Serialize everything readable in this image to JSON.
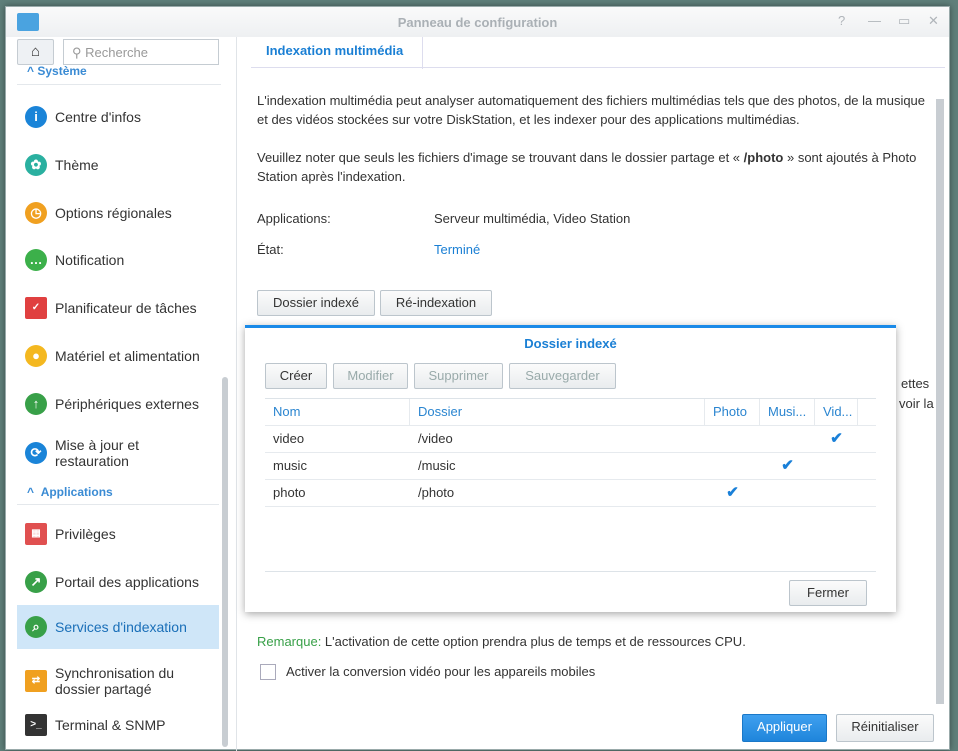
{
  "window": {
    "title": "Panneau de configuration",
    "controls": [
      "?",
      "—",
      "▭",
      "✕"
    ]
  },
  "search": {
    "placeholder": "Recherche"
  },
  "sidebar": {
    "section_system": "Système",
    "section_apps": "Applications",
    "items": [
      {
        "label": "Centre d'infos",
        "icon": "info-icon",
        "color": "#1a84d8",
        "glyph": "i"
      },
      {
        "label": "Thème",
        "icon": "palette-icon",
        "color": "#2ab0a0",
        "glyph": "✿"
      },
      {
        "label": "Options régionales",
        "icon": "regional-icon",
        "color": "#f0a020",
        "glyph": "◷"
      },
      {
        "label": "Notification",
        "icon": "chat-icon",
        "color": "#3cb04a",
        "glyph": "…"
      },
      {
        "label": "Planificateur de tâches",
        "icon": "calendar-icon",
        "color": "#e04040",
        "glyph": "✓"
      },
      {
        "label": "Matériel et alimentation",
        "icon": "bulb-icon",
        "color": "#f4b820",
        "glyph": "●"
      },
      {
        "label": "Périphériques externes",
        "icon": "upload-icon",
        "color": "#38a048",
        "glyph": "↑"
      },
      {
        "label": "Mise à jour et restauration",
        "icon": "refresh-icon",
        "color": "#1a84d8",
        "glyph": "⟳"
      },
      {
        "label": "Privilèges",
        "icon": "grid-icon",
        "color": "#e05050",
        "glyph": "▦"
      },
      {
        "label": "Portail des applications",
        "icon": "portal-icon",
        "color": "#38a048",
        "glyph": "↗"
      },
      {
        "label": "Services d'indexation",
        "icon": "index-search-icon",
        "color": "#38a048",
        "glyph": "⌕"
      },
      {
        "label": "Synchronisation du dossier partagé",
        "icon": "sync-folder-icon",
        "color": "#f0a020",
        "glyph": "⇄"
      },
      {
        "label": "Terminal & SNMP",
        "icon": "terminal-icon",
        "color": "#333333",
        "glyph": ">_"
      }
    ]
  },
  "tab": {
    "label": "Indexation multimédia"
  },
  "content": {
    "p1": "L'indexation multimédia peut analyser automatiquement des fichiers multimédias tels que des photos, de la musique et des vidéos stockées sur votre DiskStation, et les indexer pour des applications multimédias.",
    "p2a": "Veuillez noter que seuls les fichiers d'image se trouvant dans le dossier partage et « ",
    "p2b": "/photo",
    "p2c": " » sont ajoutés à Photo Station après l'indexation.",
    "apps_label": "Applications:",
    "apps_value": "Serveur multimédia, Video Station",
    "state_label": "État:",
    "state_value": "Terminé",
    "btn_indexed": "Dossier indexé",
    "btn_reindex": "Ré-indexation",
    "hidden1": "ettes",
    "hidden2": "voir la",
    "remark_label": "Remarque:",
    "remark_text": " L'activation de cette option prendra plus de temps et de ressources CPU.",
    "checkbox_label": "Activer la conversion vidéo pour les appareils mobiles",
    "apply": "Appliquer",
    "reset": "Réinitialiser"
  },
  "dialog": {
    "title": "Dossier indexé",
    "create": "Créer",
    "edit": "Modifier",
    "delete": "Supprimer",
    "save": "Sauvegarder",
    "close": "Fermer",
    "columns": [
      "Nom",
      "Dossier",
      "Photo",
      "Musi...",
      "Vid..."
    ],
    "rows": [
      {
        "name": "video",
        "folder": "/video",
        "photo": "",
        "music": "",
        "video": "✔"
      },
      {
        "name": "music",
        "folder": "/music",
        "photo": "",
        "music": "✔",
        "video": ""
      },
      {
        "name": "photo",
        "folder": "/photo",
        "photo": "✔",
        "music": "",
        "video": ""
      }
    ]
  }
}
